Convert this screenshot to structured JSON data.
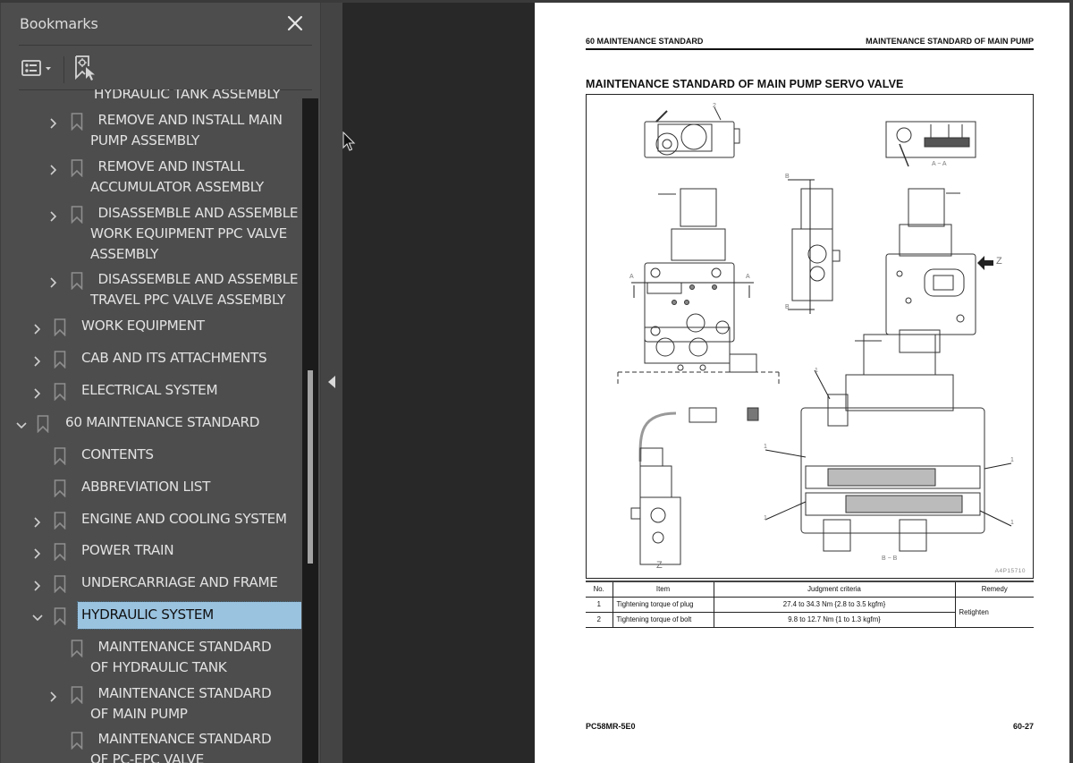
{
  "sidebar": {
    "title": "Bookmarks",
    "close_icon": "close-icon",
    "toolbar": {
      "options_icon": "list-options-icon",
      "find_icon": "find-current-bookmark-icon"
    },
    "items": [
      {
        "label": "HYDRAULIC TANK ASSEMBLY",
        "level": 2,
        "expandable": false,
        "partial": true
      },
      {
        "label": " REMOVE AND INSTALL MAIN\nPUMP ASSEMBLY",
        "level": 2,
        "expandable": true
      },
      {
        "label": " REMOVE AND INSTALL\nACCUMULATOR ASSEMBLY",
        "level": 2,
        "expandable": true
      },
      {
        "label": " DISASSEMBLE AND ASSEMBLE\nWORK EQUIPMENT PPC VALVE\nASSEMBLY",
        "level": 2,
        "expandable": true
      },
      {
        "label": " DISASSEMBLE AND ASSEMBLE\nTRAVEL PPC VALVE ASSEMBLY",
        "level": 2,
        "expandable": true
      },
      {
        "label": "WORK EQUIPMENT",
        "level": 1,
        "expandable": true
      },
      {
        "label": "CAB AND ITS ATTACHMENTS",
        "level": 1,
        "expandable": true
      },
      {
        "label": "ELECTRICAL SYSTEM",
        "level": 1,
        "expandable": true
      },
      {
        "label": "60 MAINTENANCE STANDARD",
        "level": 0,
        "expandable": true,
        "expanded": true
      },
      {
        "label": "CONTENTS",
        "level": 1,
        "expandable": false
      },
      {
        "label": "ABBREVIATION LIST",
        "level": 1,
        "expandable": false
      },
      {
        "label": "ENGINE AND COOLING SYSTEM",
        "level": 1,
        "expandable": true
      },
      {
        "label": "POWER TRAIN",
        "level": 1,
        "expandable": true
      },
      {
        "label": "UNDERCARRIAGE AND FRAME",
        "level": 1,
        "expandable": true
      },
      {
        "label": "HYDRAULIC SYSTEM",
        "level": 1,
        "expandable": true,
        "expanded": true,
        "selected": true
      },
      {
        "label": " MAINTENANCE STANDARD\nOF HYDRAULIC TANK",
        "level": 2,
        "expandable": false
      },
      {
        "label": " MAINTENANCE STANDARD\nOF MAIN PUMP",
        "level": 2,
        "expandable": true
      },
      {
        "label": " MAINTENANCE STANDARD\nOF PC-EPC VALVE",
        "level": 2,
        "expandable": false
      }
    ]
  },
  "viewer": {
    "collapse_icon": "collapse-panel-left-icon"
  },
  "page": {
    "header_left": "60 MAINTENANCE STANDARD",
    "header_right": "MAINTENANCE STANDARD OF MAIN PUMP",
    "title": "MAINTENANCE STANDARD OF MAIN PUMP SERVO VALVE",
    "figure": {
      "code": "A4P15710",
      "labels": {
        "section_aa": "A − A",
        "section_bb": "B − B",
        "view_z": "Z",
        "arrow_z": "Z",
        "a": "A",
        "b": "B",
        "callout_1": "1",
        "callout_2": "2"
      }
    },
    "table": {
      "headers": [
        "No.",
        "Item",
        "Judgment criteria",
        "Remedy"
      ],
      "rows": [
        {
          "no": "1",
          "item": "Tightening torque of plug",
          "criteria": "27.4 to 34.3 Nm {2.8 to 3.5 kgfm}"
        },
        {
          "no": "2",
          "item": "Tightening torque of bolt",
          "criteria": "9.8 to 12.7 Nm {1 to 1.3 kgfm}"
        }
      ],
      "remedy": "Retighten"
    },
    "footer_left": "PC58MR-5E0",
    "footer_right": "60-27"
  }
}
